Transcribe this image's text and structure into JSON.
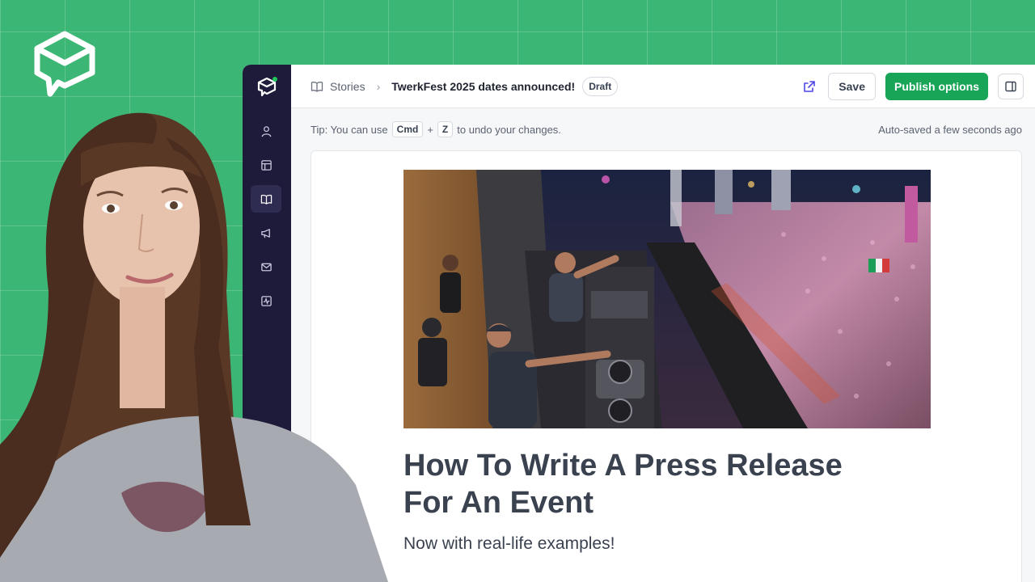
{
  "breadcrumb": {
    "section": "Stories",
    "current": "TwerkFest 2025 dates announced!",
    "status": "Draft"
  },
  "toolbar": {
    "save_label": "Save",
    "publish_label": "Publish options"
  },
  "tip": {
    "prefix": "Tip: You can use",
    "key1": "Cmd",
    "plus": "+",
    "key2": "Z",
    "suffix": "to undo your changes."
  },
  "autosave": "Auto-saved a few seconds ago",
  "article": {
    "title_line1": "How To Write A Press Release",
    "title_line2": "For An Event",
    "subtitle": "Now with real-life examples!"
  },
  "rail": {
    "items": [
      "person-icon",
      "layout-icon",
      "book-open-icon",
      "megaphone-icon",
      "mail-icon",
      "activity-icon"
    ],
    "active_index": 2
  },
  "colors": {
    "background": "#3cb675",
    "rail": "#1e1b3a",
    "publish": "#18a558",
    "status_dot": "#22c55e"
  }
}
